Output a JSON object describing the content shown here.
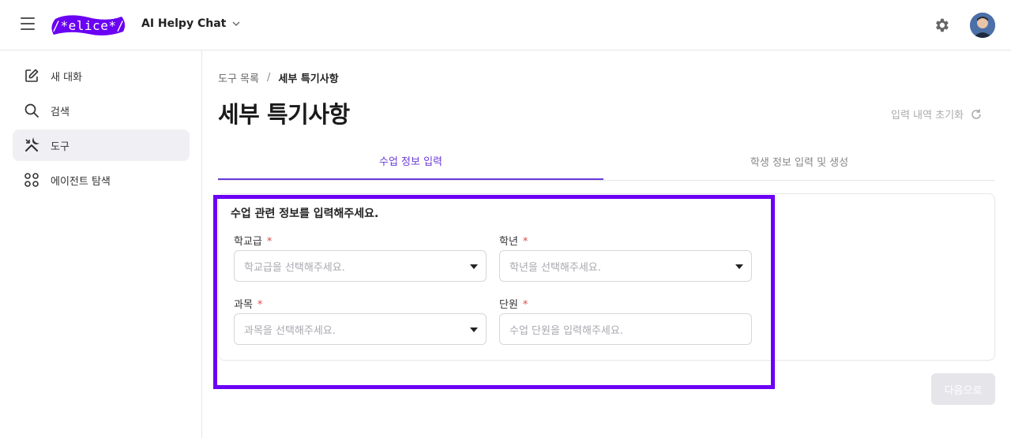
{
  "header": {
    "logo_text": "/*elice*/",
    "app_title": "AI Helpy Chat",
    "brand_color": "#6a00f4"
  },
  "sidebar": {
    "items": [
      {
        "label": "새 대화",
        "icon": "edit-icon"
      },
      {
        "label": "검색",
        "icon": "search-icon"
      },
      {
        "label": "도구",
        "icon": "tools-icon",
        "active": true
      },
      {
        "label": "에이전트 탐색",
        "icon": "grid-icon"
      }
    ]
  },
  "breadcrumb": {
    "parent": "도구 목록",
    "separator": "/",
    "current": "세부 특기사항"
  },
  "page": {
    "title": "세부 특기사항",
    "reset_label": "입력 내역 초기화"
  },
  "tabs": [
    {
      "label": "수업 정보 입력",
      "active": true
    },
    {
      "label": "학생 정보 입력 및 생성",
      "active": false
    }
  ],
  "form": {
    "heading": "수업 관련 정보를 입력해주세요.",
    "required_mark": "*",
    "fields": {
      "school_level": {
        "label": "학교급",
        "placeholder": "학교급을 선택해주세요."
      },
      "grade": {
        "label": "학년",
        "placeholder": "학년을 선택해주세요."
      },
      "subject": {
        "label": "과목",
        "placeholder": "과목을 선택해주세요."
      },
      "unit": {
        "label": "단원",
        "placeholder": "수업 단원을 입력해주세요."
      }
    }
  },
  "actions": {
    "next_label": "다음으로"
  }
}
